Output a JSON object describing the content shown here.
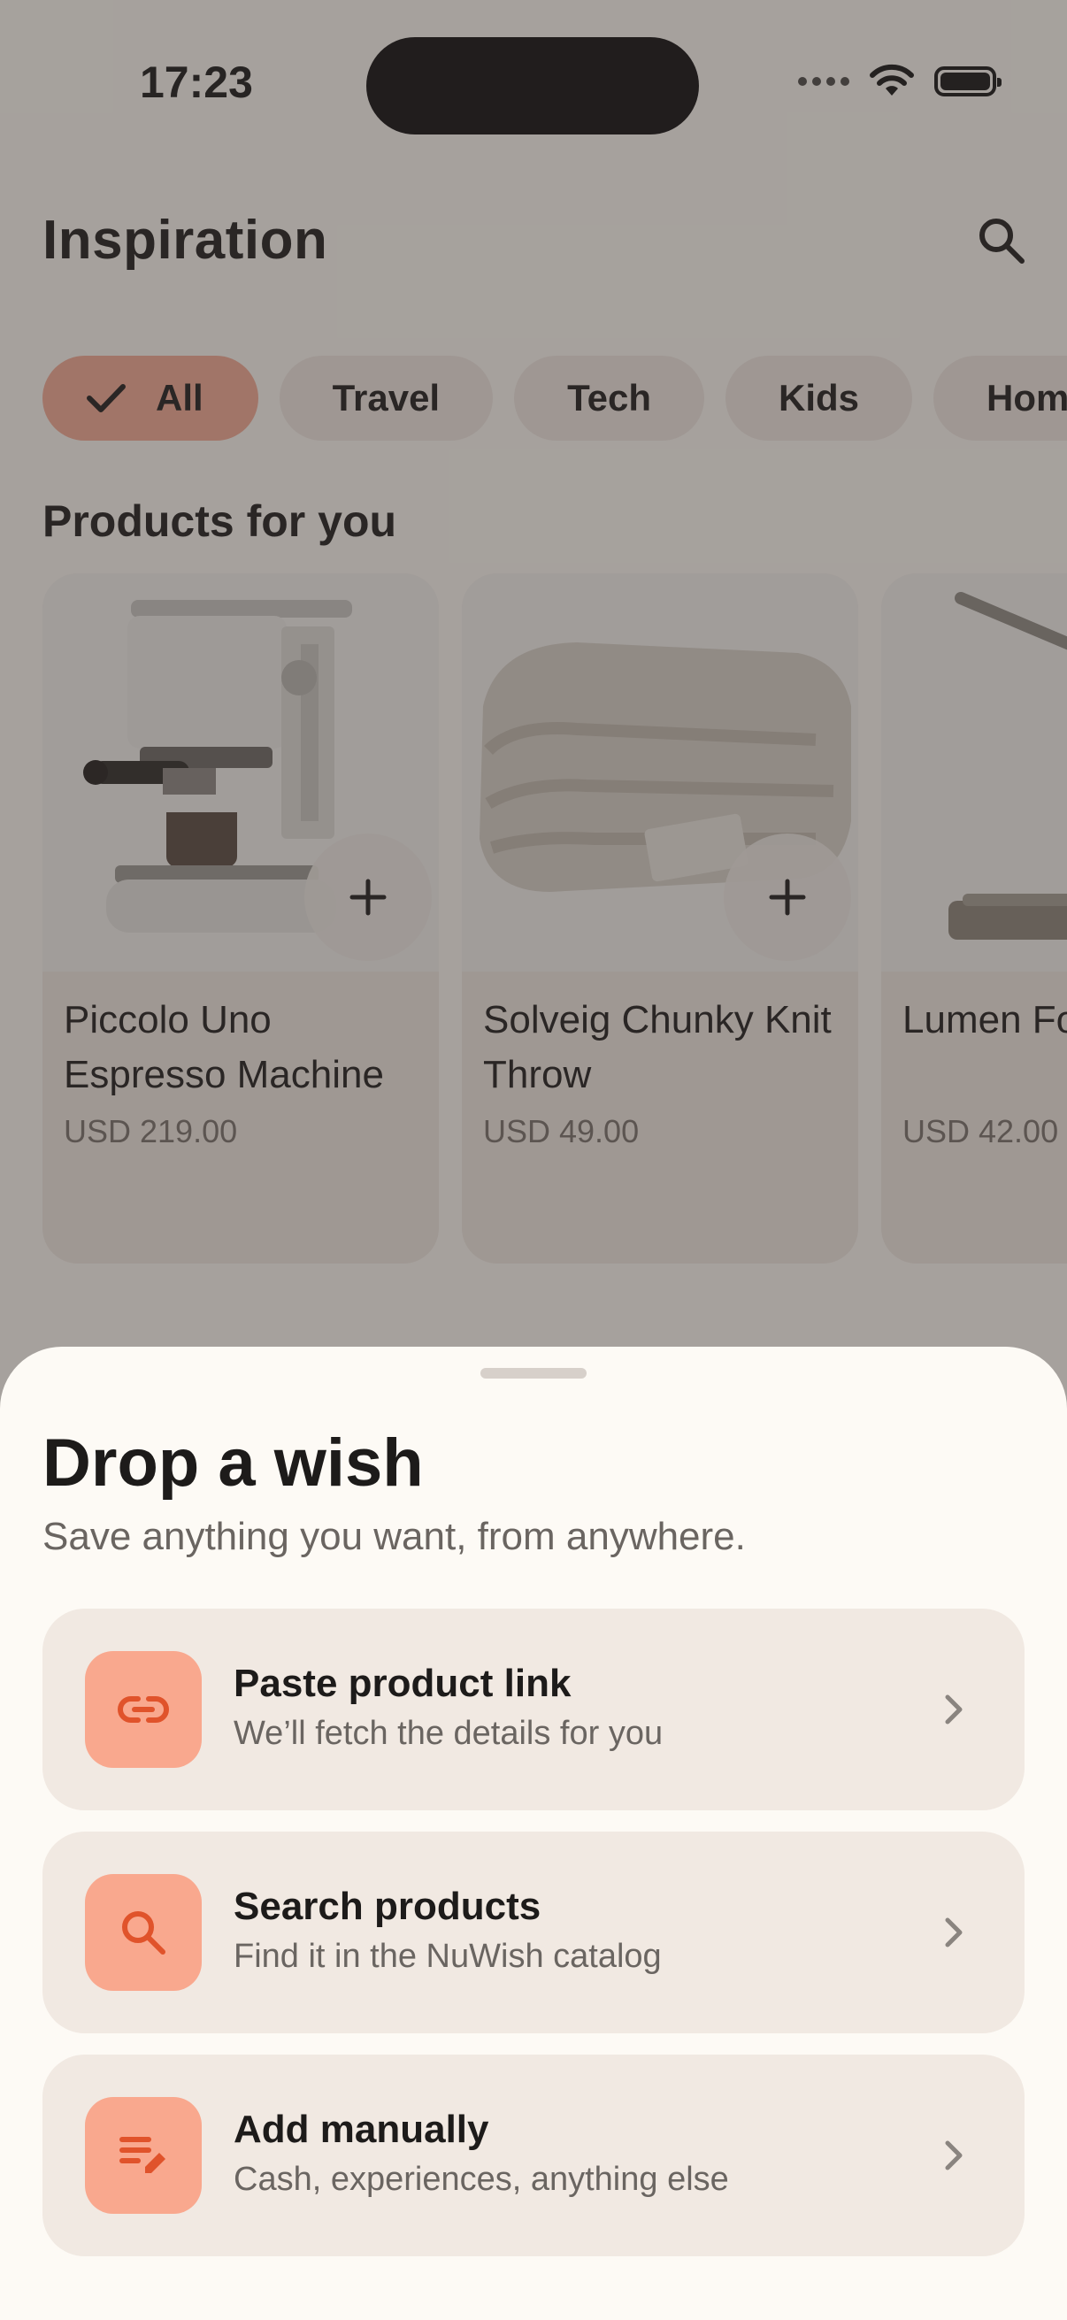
{
  "status_bar": {
    "time": "17:23"
  },
  "header": {
    "title": "Inspiration",
    "search_icon": "search-icon"
  },
  "filters": {
    "chips": [
      {
        "label": "All",
        "active": true
      },
      {
        "label": "Travel"
      },
      {
        "label": "Tech"
      },
      {
        "label": "Kids"
      },
      {
        "label": "Hom"
      }
    ]
  },
  "products_section": {
    "title": "Products for you",
    "items": [
      {
        "name": "Piccolo Uno Espresso Machine",
        "price": "USD 219.00",
        "image": "espresso-machine"
      },
      {
        "name": "Solveig Chunky Knit Throw",
        "price": "USD 49.00",
        "image": "knit-throw"
      },
      {
        "name": "Lumen Fo Lamp",
        "price": "USD 42.00",
        "image": "desk-lamp"
      }
    ]
  },
  "sheet": {
    "title": "Drop a wish",
    "subtitle": "Save anything you want, from anywhere.",
    "options": [
      {
        "title": "Paste product link",
        "subtitle": "We’ll fetch the details for you",
        "icon": "link-icon"
      },
      {
        "title": "Search products",
        "subtitle": "Find it in the NuWish catalog",
        "icon": "search-icon"
      },
      {
        "title": "Add manually",
        "subtitle": "Cash, experiences, anything else",
        "icon": "edit-list-icon"
      }
    ]
  },
  "colors": {
    "accent": "#f9a88e",
    "accent_icon": "#e0532b",
    "sheet_bg": "#fdfaf5",
    "card_bg": "#f1e9e2"
  }
}
